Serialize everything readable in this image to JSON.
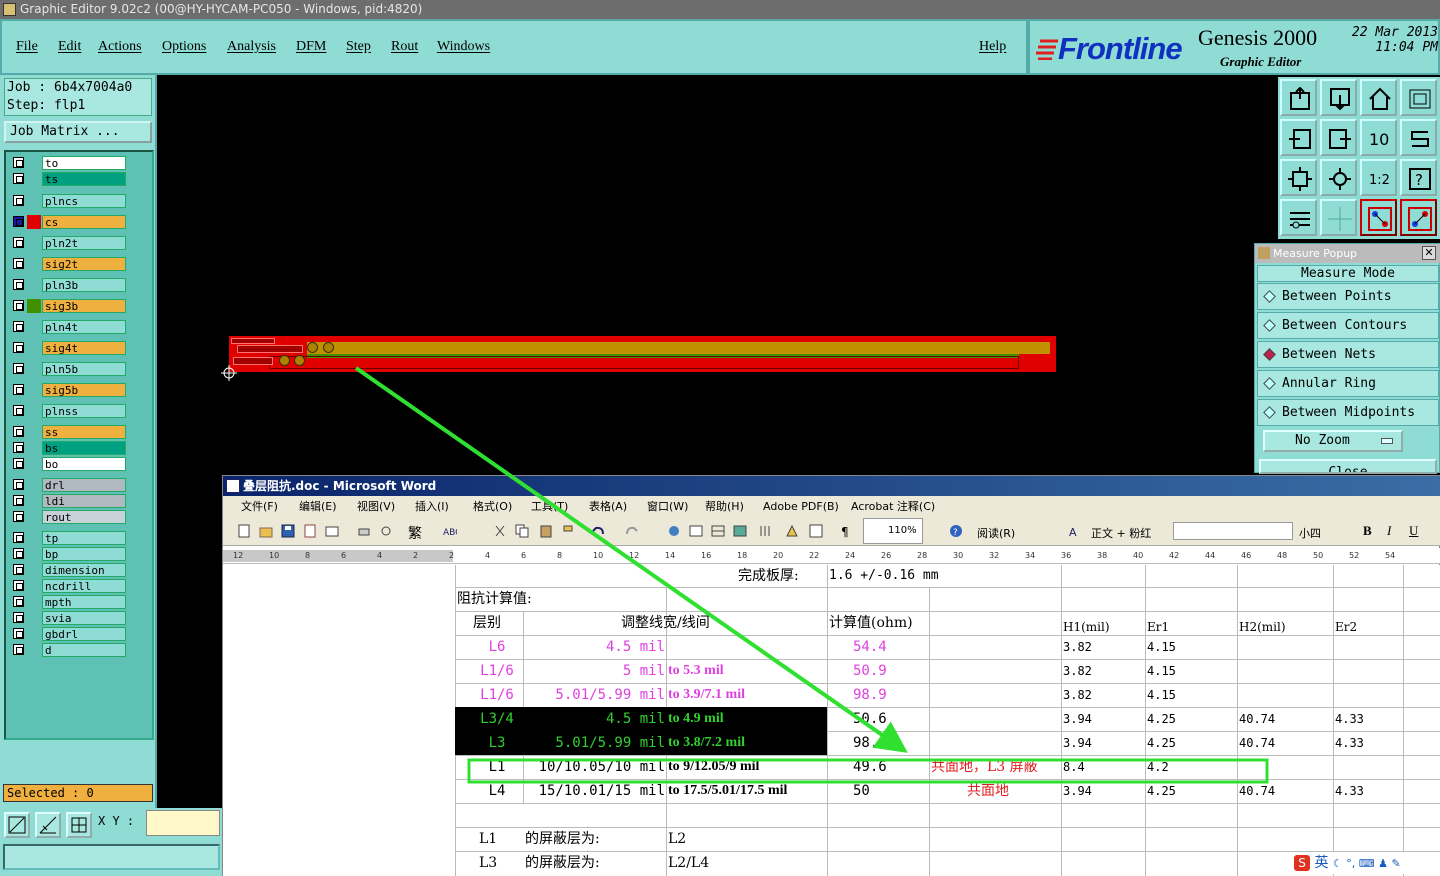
{
  "window_title": "Graphic Editor 9.02c2 (00@HY-HYCAM-PC050 - Windows, pid:4820)",
  "menu": [
    "File",
    "Edit",
    "Actions",
    "Options",
    "Analysis",
    "DFM",
    "Step",
    "Rout",
    "Windows"
  ],
  "help_label": "Help",
  "brand": {
    "logo": "Frontline",
    "product": "Genesis 2000",
    "subtitle": "Graphic Editor",
    "date": "22 Mar 2013",
    "time": "11:04 PM"
  },
  "job": {
    "job_line": "Job : 6b4x7004a0",
    "step_line": "Step: flp1",
    "matrix_label": "Job Matrix ..."
  },
  "layers": [
    {
      "name": "to",
      "color": "#ffffff"
    },
    {
      "name": "ts",
      "color": "#00a080"
    },
    {
      "name": "plncs",
      "color": "#8fdcd4"
    },
    {
      "name": "cs",
      "color": "#f0b040"
    },
    {
      "name": "pln2t",
      "color": "#8fdcd4"
    },
    {
      "name": "sig2t",
      "color": "#f0b040"
    },
    {
      "name": "pln3b",
      "color": "#8fdcd4"
    },
    {
      "name": "sig3b",
      "color": "#f0b040"
    },
    {
      "name": "pln4t",
      "color": "#8fdcd4"
    },
    {
      "name": "sig4t",
      "color": "#f0b040"
    },
    {
      "name": "pln5b",
      "color": "#8fdcd4"
    },
    {
      "name": "sig5b",
      "color": "#f0b040"
    },
    {
      "name": "plnss",
      "color": "#8fdcd4"
    },
    {
      "name": "ss",
      "color": "#f0b040"
    },
    {
      "name": "bs",
      "color": "#00a080"
    },
    {
      "name": "bo",
      "color": "#ffffff"
    },
    {
      "name": "drl",
      "color": "#b0b8c0"
    },
    {
      "name": "ldi",
      "color": "#b0b8c0"
    },
    {
      "name": "rout",
      "color": "#c8d0d8"
    },
    {
      "name": "tp",
      "color": "#8fdcd4"
    },
    {
      "name": "bp",
      "color": "#8fdcd4"
    },
    {
      "name": "dimension",
      "color": "#8fdcd4"
    },
    {
      "name": "ncdrill",
      "color": "#8fdcd4"
    },
    {
      "name": "mpth",
      "color": "#8fdcd4"
    },
    {
      "name": "svia",
      "color": "#8fdcd4"
    },
    {
      "name": "gbdrl",
      "color": "#8fdcd4"
    },
    {
      "name": "d",
      "color": "#8fdcd4"
    }
  ],
  "selected_label": "Selected : 0",
  "xy_label": "X Y :",
  "measure_popup": {
    "title": "Measure Popup",
    "mode_label": "Measure Mode",
    "options": [
      "Between Points",
      "Between Contours",
      "Between Nets",
      "Annular Ring",
      "Between Midpoints"
    ],
    "selected_option": "Between Nets",
    "zoom_label": "No Zoom",
    "close_label": "Close"
  },
  "word": {
    "title": "叠层阻抗.doc - Microsoft Word",
    "menu": [
      "文件(F)",
      "编辑(E)",
      "视图(V)",
      "插入(I)",
      "格式(O)",
      "工具(T)",
      "表格(A)",
      "窗口(W)",
      "帮助(H)",
      "Adobe PDF(B)",
      "Acrobat 注释(C)"
    ],
    "zoom": "110%",
    "read_label": "阅读(R)",
    "style": "正文 + 粉红",
    "font_size": "小四",
    "ruler_numbers": [
      "12",
      "10",
      "8",
      "6",
      "4",
      "2",
      "2",
      "4",
      "6",
      "8",
      "10",
      "12",
      "14",
      "16",
      "18",
      "20",
      "22",
      "24",
      "26",
      "28",
      "30",
      "32",
      "34",
      "36",
      "38",
      "40",
      "42",
      "44",
      "46",
      "48",
      "50",
      "52",
      "54"
    ],
    "board_thickness_label": "完成板厚:",
    "board_thickness_value": "1.6 +/-0.16 mm",
    "impedance_title": "阻抗计算值:",
    "headers": {
      "layer": "层别",
      "adjust": "调整线宽/线间",
      "calc": "计算值(ohm)",
      "h1": "H1(mil)",
      "er1": "Er1",
      "h2": "H2(mil)",
      "er2": "Er2"
    },
    "rows": [
      {
        "layer": "L6",
        "width": "4.5 mil",
        "adjust": "",
        "calc": "54.4",
        "note": "",
        "h1": "3.82",
        "er1": "4.15",
        "h2": "",
        "er2": ""
      },
      {
        "layer": "L1/6",
        "width": "5 mil",
        "adjust": "to 5.3 mil",
        "calc": "50.9",
        "note": "",
        "h1": "3.82",
        "er1": "4.15",
        "h2": "",
        "er2": ""
      },
      {
        "layer": "L1/6",
        "width": "5.01/5.99 mil",
        "adjust": "to 3.9/7.1 mil",
        "calc": "98.9",
        "note": "",
        "h1": "3.82",
        "er1": "4.15",
        "h2": "",
        "er2": ""
      },
      {
        "layer": "L3/4",
        "width": "4.5 mil",
        "adjust": "to 4.9 mil",
        "calc": "50.6",
        "note": "",
        "h1": "3.94",
        "er1": "4.25",
        "h2": "40.74",
        "er2": "4.33"
      },
      {
        "layer": "L3",
        "width": "5.01/5.99 mil",
        "adjust": "to 3.8/7.2 mil",
        "calc": "98.6",
        "note": "",
        "h1": "3.94",
        "er1": "4.25",
        "h2": "40.74",
        "er2": "4.33"
      },
      {
        "layer": "L1",
        "width": "10/10.05/10 mil",
        "adjust": "to 9/12.05/9 mil",
        "calc": "49.6",
        "note": "共面地，L3 屏蔽",
        "h1": "8.4",
        "er1": "4.2",
        "h2": "",
        "er2": ""
      },
      {
        "layer": "L4",
        "width": "15/10.01/15 mil",
        "adjust": "to 17.5/5.01/17.5 mil",
        "calc": "50",
        "note": "共面地",
        "h1": "3.94",
        "er1": "4.25",
        "h2": "40.74",
        "er2": "4.33"
      }
    ],
    "shield_rows": [
      {
        "layer": "L1",
        "label": "的屏蔽层为:",
        "value": "L2"
      },
      {
        "layer": "L3",
        "label": "的屏蔽层为:",
        "value": "L2/L4"
      }
    ],
    "ime_label": "英"
  },
  "colors": {
    "teal": "#8fdcd4",
    "accent_green": "#20e020",
    "pink": "#e040e0",
    "green_text": "#30d030"
  }
}
